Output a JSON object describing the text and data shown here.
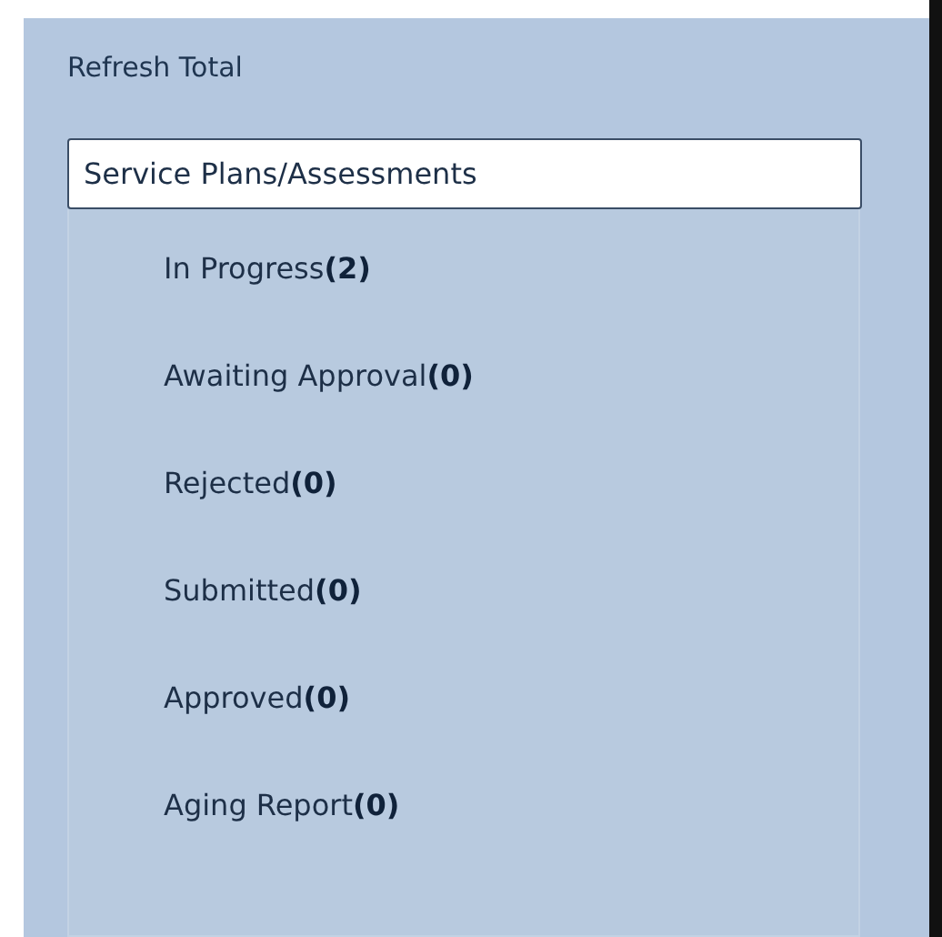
{
  "refresh": {
    "label": "Refresh Total"
  },
  "section": {
    "title": "Service Plans/Assessments"
  },
  "items": [
    {
      "label": "In Progress",
      "count": "(2)"
    },
    {
      "label": "Awaiting Approval",
      "count": "(0)"
    },
    {
      "label": "Rejected",
      "count": "(0)"
    },
    {
      "label": "Submitted",
      "count": "(0)"
    },
    {
      "label": "Approved",
      "count": "(0)"
    },
    {
      "label": "Aging Report",
      "count": "(0)"
    }
  ]
}
